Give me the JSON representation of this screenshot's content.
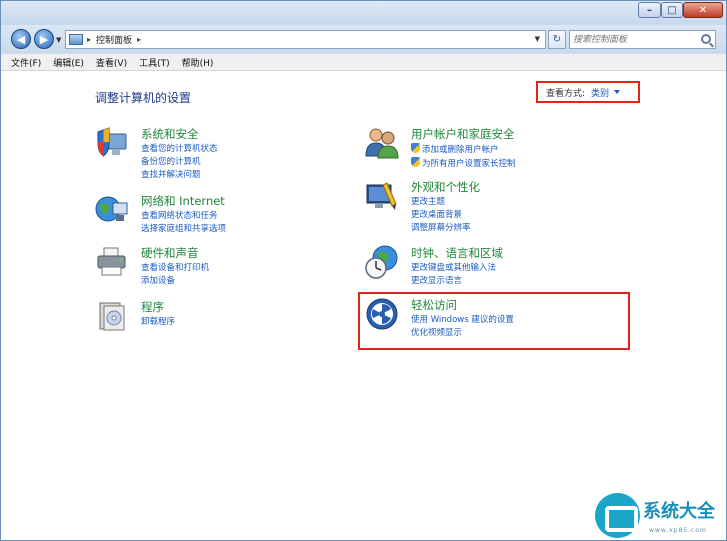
{
  "address": {
    "path": "控制面板",
    "search_placeholder": "搜索控制面板"
  },
  "menu": [
    "文件(F)",
    "编辑(E)",
    "查看(V)",
    "工具(T)",
    "帮助(H)"
  ],
  "page_title": "调整计算机的设置",
  "view_by": {
    "label": "查看方式:",
    "value": "类别"
  },
  "categories": {
    "security": {
      "title": "系统和安全",
      "icon": "shield-computer-icon",
      "links": [
        "查看您的计算机状态",
        "备份您的计算机",
        "查找并解决问题"
      ]
    },
    "network": {
      "title": "网络和 Internet",
      "icon": "network-globe-icon",
      "links": [
        "查看网络状态和任务",
        "选择家庭组和共享选项"
      ]
    },
    "hardware": {
      "title": "硬件和声音",
      "icon": "printer-icon",
      "links": [
        "查看设备和打印机",
        "添加设备"
      ]
    },
    "programs": {
      "title": "程序",
      "icon": "programs-icon",
      "links": [
        "卸载程序"
      ]
    },
    "users": {
      "title": "用户帐户和家庭安全",
      "icon": "users-icon",
      "links": [
        "添加或删除用户帐户",
        "为所有用户设置家长控制"
      ]
    },
    "appearance": {
      "title": "外观和个性化",
      "icon": "appearance-icon",
      "links": [
        "更改主题",
        "更改桌面背景",
        "调整屏幕分辨率"
      ]
    },
    "clock": {
      "title": "时钟、语言和区域",
      "icon": "clock-globe-icon",
      "links": [
        "更改键盘或其他输入法",
        "更改显示语言"
      ]
    },
    "ease": {
      "title": "轻松访问",
      "icon": "ease-of-access-icon",
      "links": [
        "使用 Windows 建议的设置",
        "优化视频显示"
      ]
    }
  },
  "watermark": {
    "name": "系统大全",
    "url": "www.xp85.com"
  },
  "colors": {
    "title_green": "#20873a",
    "link_blue": "#1a5bc4",
    "highlight_red": "#e32619"
  }
}
